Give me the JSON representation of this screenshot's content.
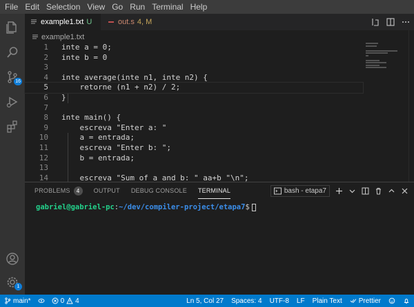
{
  "menu": [
    "File",
    "Edit",
    "Selection",
    "View",
    "Go",
    "Run",
    "Terminal",
    "Help"
  ],
  "activity": {
    "source_control_badge": "16",
    "settings_badge": "1"
  },
  "tabs": [
    {
      "name": "example1.txt",
      "status": "U",
      "active": true
    },
    {
      "name": "out.s",
      "status": "4, M",
      "active": false
    }
  ],
  "breadcrumb": "example1.txt",
  "code_lines": [
    {
      "n": "1",
      "text": "inte a = 0;"
    },
    {
      "n": "2",
      "text": "inte b = 0"
    },
    {
      "n": "3",
      "text": ""
    },
    {
      "n": "4",
      "text": "inte average(inte n1, inte n2) {"
    },
    {
      "n": "5",
      "text": "    retorne (n1 + n2) / 2;"
    },
    {
      "n": "6",
      "text": "}"
    },
    {
      "n": "7",
      "text": ""
    },
    {
      "n": "8",
      "text": "inte main() {"
    },
    {
      "n": "9",
      "text": "    escreva \"Enter a: \""
    },
    {
      "n": "10",
      "text": "    a = entrada;"
    },
    {
      "n": "11",
      "text": "    escreva \"Enter b: \";"
    },
    {
      "n": "12",
      "text": "    b = entrada;"
    },
    {
      "n": "13",
      "text": ""
    },
    {
      "n": "14",
      "text": "    escreva \"Sum of a and b: \" aa+b \"\\n\";"
    }
  ],
  "panel": {
    "tabs": [
      "PROBLEMS",
      "OUTPUT",
      "DEBUG CONSOLE",
      "TERMINAL"
    ],
    "problems_count": "4",
    "active_tab": "TERMINAL",
    "terminal_selector": "bash - etapa7"
  },
  "terminal": {
    "user": "gabriel@gabriel-pc",
    "sep": ":",
    "path": "~/dev/compiler-project/etapa7",
    "prompt": "$"
  },
  "statusbar": {
    "branch": "main*",
    "errors": "0",
    "warnings": "4",
    "position": "Ln 5, Col 27",
    "spaces": "Spaces: 4",
    "encoding": "UTF-8",
    "eol": "LF",
    "language": "Plain Text",
    "formatter": "Prettier"
  },
  "colors": {
    "statusbar": "#007acc",
    "activitybar": "#333333",
    "editor_bg": "#1e1e1e",
    "terminal_user": "#23d18b",
    "terminal_path": "#3b8eea"
  }
}
